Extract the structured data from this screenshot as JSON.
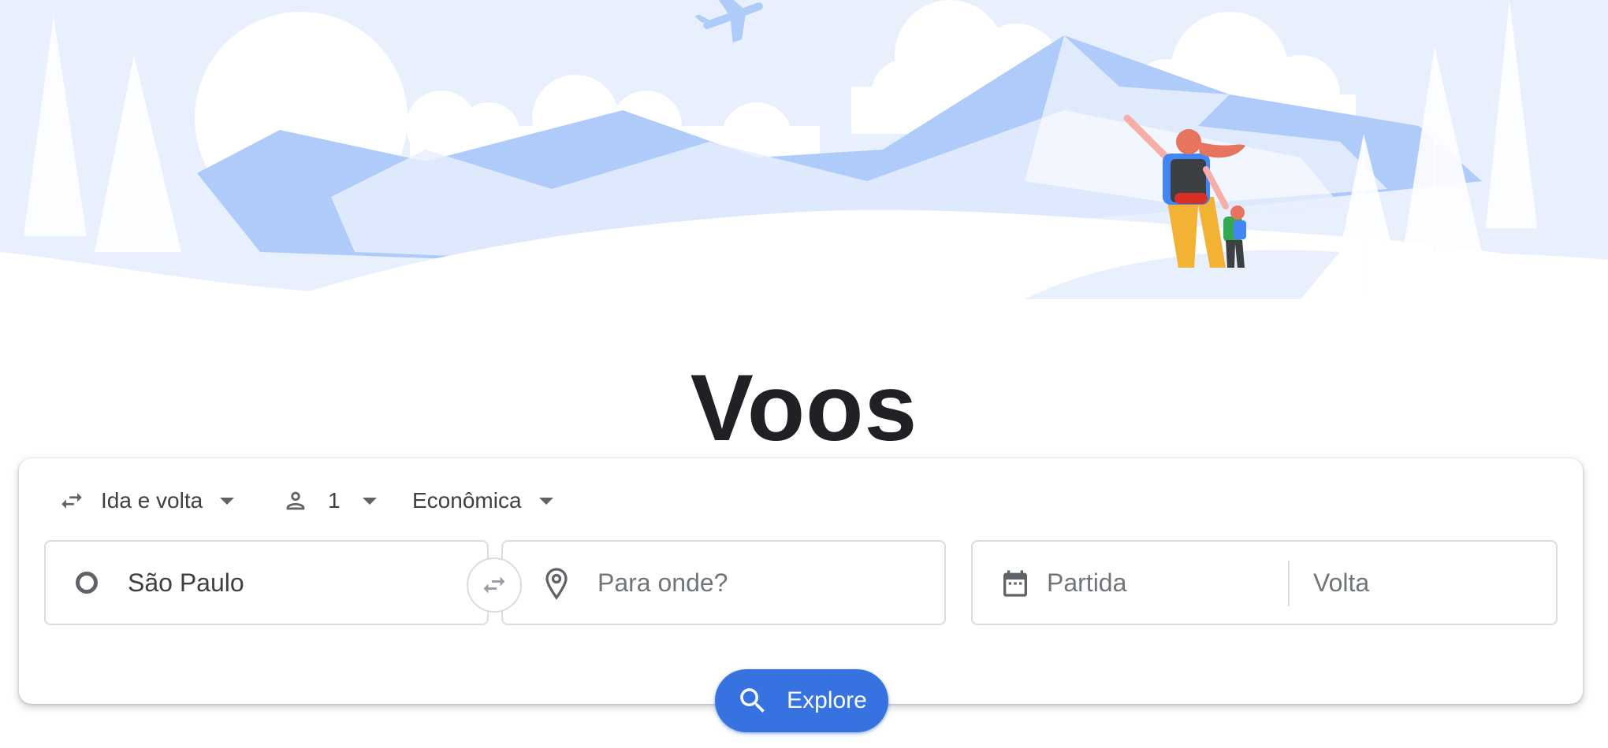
{
  "page": {
    "title": "Voos"
  },
  "trip_options": {
    "trip_type": "Ida e volta",
    "passengers": "1",
    "cabin_class": "Econômica"
  },
  "search": {
    "origin_value": "São Paulo",
    "destination_placeholder": "Para onde?",
    "departure_placeholder": "Partida",
    "return_placeholder": "Volta",
    "explore_label": "Explore"
  },
  "icons": {
    "trip_type": "swap-arrows-icon",
    "passengers": "person-icon",
    "origin": "circle-origin-icon",
    "swap": "swap-arrows-icon",
    "destination": "location-pin-icon",
    "dates": "calendar-icon",
    "explore": "search-icon",
    "dropdown": "caret-down-icon"
  },
  "colors": {
    "accent": "#1a73e8",
    "sky": "#e8effd",
    "mountains": "#aecbfa",
    "text": "#202124"
  }
}
